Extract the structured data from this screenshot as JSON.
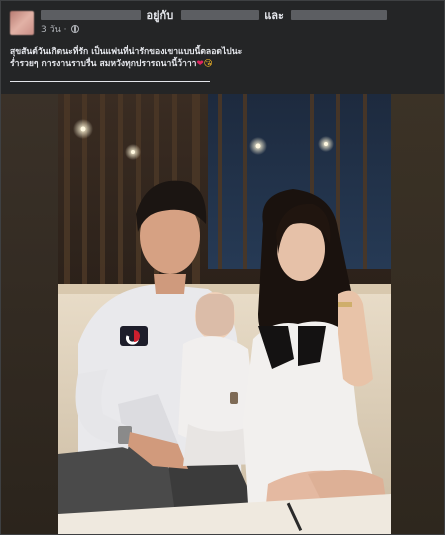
{
  "post": {
    "header": {
      "connector_with": "อยู่กับ",
      "connector_and": "และ",
      "timestamp": "3 วัน",
      "separator": "·",
      "privacy_icon": "globe-icon"
    },
    "caption": {
      "line1": "สุขสันต์วันเกิดนะที่รัก เป็นแฟนที่น่ารักของเขาแบบนี้ตลอดไปนะ",
      "line2": "ร่ำรวยๆ การงานราบรื่น สมหวังทุกปรารถนานี้ว้าาา",
      "heart": "❤",
      "emoji": "😘"
    },
    "photo": {
      "description_icon": "photo-icon"
    }
  },
  "colors": {
    "background": "#242526",
    "text_primary": "#e4e6eb",
    "text_secondary": "#b0b3b8",
    "heart": "#e0245e"
  }
}
